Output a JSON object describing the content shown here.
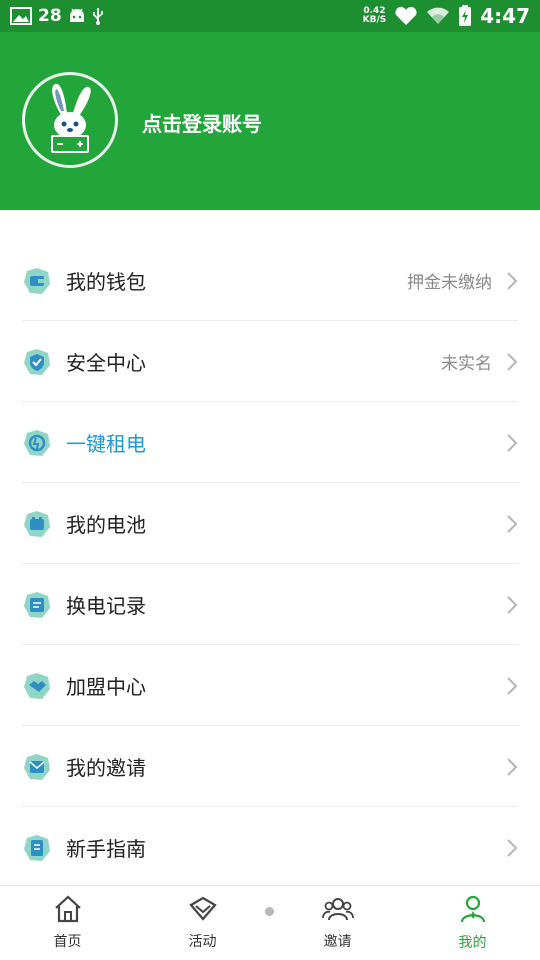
{
  "status_bar": {
    "time": "4:47",
    "notification_count": "28",
    "net_speed_value": "0.42",
    "net_speed_unit": "KB/S",
    "icons": [
      "image-icon",
      "android-icon",
      "usb-icon",
      "heart-icon",
      "wifi-icon",
      "battery-charging-icon",
      "alarm-icon"
    ]
  },
  "header": {
    "login_text": "点击登录账号",
    "avatar_icon": "rabbit-battery-logo",
    "background": "#22a53a"
  },
  "menu": {
    "items": [
      {
        "label": "我的钱包",
        "value": "押金未缴纳",
        "icon": "wallet-icon"
      },
      {
        "label": "安全中心",
        "value": "未实名",
        "icon": "shield-icon"
      },
      {
        "label": "一键租电",
        "value": "",
        "icon": "power-icon",
        "active": true
      },
      {
        "label": "我的电池",
        "value": "",
        "icon": "battery-icon"
      },
      {
        "label": "换电记录",
        "value": "",
        "icon": "record-icon"
      },
      {
        "label": "加盟中心",
        "value": "",
        "icon": "handshake-icon"
      },
      {
        "label": "我的邀请",
        "value": "",
        "icon": "invite-icon"
      },
      {
        "label": "新手指南",
        "value": "",
        "icon": "guide-icon"
      }
    ]
  },
  "tabbar": {
    "tabs": [
      {
        "label": "首页",
        "icon": "home-icon"
      },
      {
        "label": "活动",
        "icon": "activity-icon"
      },
      {
        "label": "邀请",
        "icon": "people-icon"
      },
      {
        "label": "我的",
        "icon": "user-icon",
        "active": true
      }
    ],
    "accent": "#22a53a"
  }
}
